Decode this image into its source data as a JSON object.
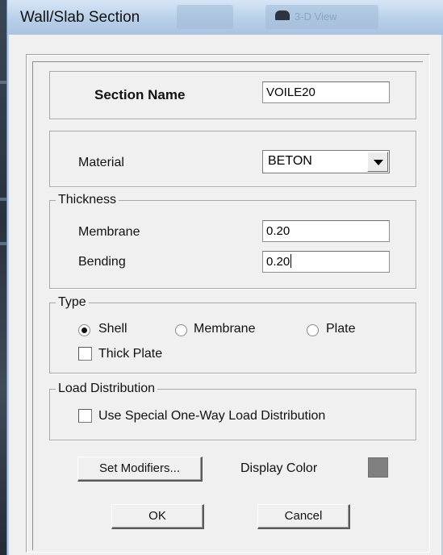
{
  "window": {
    "title": "Wall/Slab Section",
    "background_tab_text": "3-D View"
  },
  "section_name": {
    "label": "Section Name",
    "value": "VOILE20"
  },
  "material": {
    "label": "Material",
    "selected": "BETON"
  },
  "thickness": {
    "legend": "Thickness",
    "membrane_label": "Membrane",
    "membrane_value": "0.20",
    "bending_label": "Bending",
    "bending_value": "0.20"
  },
  "type": {
    "legend": "Type",
    "options": [
      "Shell",
      "Membrane",
      "Plate"
    ],
    "selected": "Shell",
    "thick_plate_label": "Thick Plate",
    "thick_plate_checked": false
  },
  "load_distribution": {
    "legend": "Load Distribution",
    "checkbox_label": "Use Special One-Way Load Distribution",
    "checked": false
  },
  "modifiers": {
    "button_label": "Set Modifiers...",
    "display_color_label": "Display Color",
    "display_color": "#808080"
  },
  "actions": {
    "ok_label": "OK",
    "cancel_label": "Cancel"
  }
}
